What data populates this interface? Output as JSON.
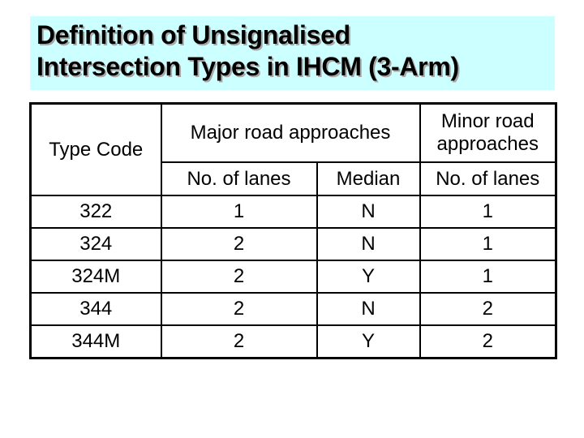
{
  "slide": {
    "title_lines": [
      "Definition of Unsignalised",
      "Intersection Types in IHCM (3-Arm)"
    ],
    "title_background": "#ccffff"
  },
  "table": {
    "headers": {
      "type_code": "Type Code",
      "major_group": "Major road approaches",
      "minor_group_line1": "Minor road",
      "minor_group_line2": "approaches",
      "major_lanes": "No. of lanes",
      "major_median": "Median",
      "minor_lanes": "No. of lanes"
    },
    "rows": [
      {
        "type_code": "322",
        "major_lanes": "1",
        "median": "N",
        "minor_lanes": "1"
      },
      {
        "type_code": "324",
        "major_lanes": "2",
        "median": "N",
        "minor_lanes": "1"
      },
      {
        "type_code": "324M",
        "major_lanes": "2",
        "median": "Y",
        "minor_lanes": "1"
      },
      {
        "type_code": "344",
        "major_lanes": "2",
        "median": "N",
        "minor_lanes": "2"
      },
      {
        "type_code": "344M",
        "major_lanes": "2",
        "median": "Y",
        "minor_lanes": "2"
      }
    ]
  }
}
